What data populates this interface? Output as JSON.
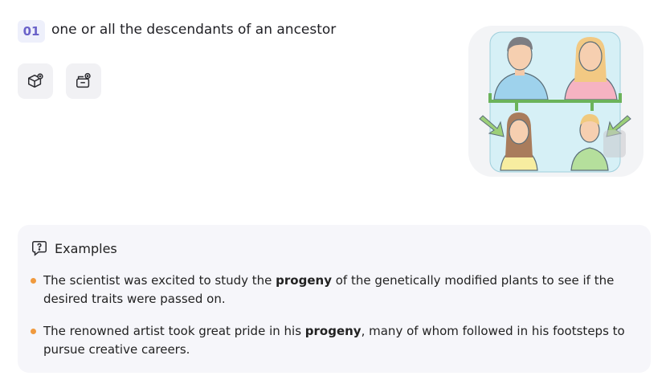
{
  "entry": {
    "number": "01",
    "definition": "one or all the descendants of an ancestor"
  },
  "actions": {
    "icons": [
      "cube-plus-icon",
      "archive-plus-icon"
    ]
  },
  "examples": {
    "heading": "Examples",
    "items": [
      {
        "before": "The scientist was excited to study the ",
        "highlight": "progeny",
        "after": " of the genetically modified plants to see if the desired traits were passed on."
      },
      {
        "before": "The renowned artist took great pride in his ",
        "highlight": "progeny",
        "after": ", many of whom followed in his footsteps to pursue creative careers."
      }
    ]
  },
  "colors": {
    "accent": "#6a62c9",
    "bullet": "#f09a3e",
    "panel": "#f6f6fa",
    "illustration_bracket": "#6bb35a"
  }
}
